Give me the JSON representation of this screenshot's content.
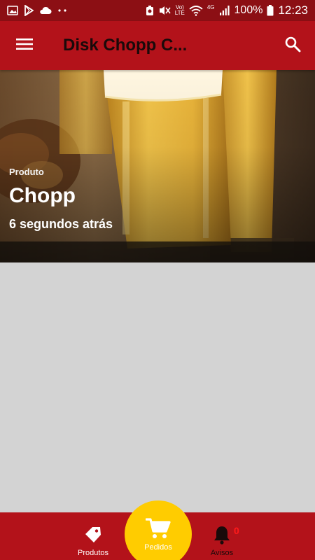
{
  "status_bar": {
    "battery_percent": "100%",
    "time": "12:23",
    "volte_label": "Vo)\nLTE",
    "network_label": "4G",
    "colors": {
      "background": "#8c0f14",
      "icons": "#ffffff"
    },
    "icons": [
      "gallery-icon",
      "play-store-icon",
      "cloud-icon",
      "dots-icon",
      "alarm-icon",
      "mute-icon",
      "volte-icon",
      "wifi-icon",
      "signal-icon",
      "battery-icon"
    ]
  },
  "app_bar": {
    "title": "Disk Chopp C...",
    "menu_icon": "hamburger-menu-icon",
    "search_icon": "search-icon",
    "background": "#b3121a"
  },
  "feed": {
    "items": [
      {
        "category": "Produto",
        "title": "Chopp",
        "time_ago": "6 segundos atrás"
      }
    ]
  },
  "bottom_nav": {
    "background": "#b3121a",
    "items": [
      {
        "label": "Produtos",
        "icon": "tag-icon"
      },
      {
        "label": "Pedidos",
        "icon": "cart-icon",
        "accent": "#ffcc00"
      },
      {
        "label": "Avisos",
        "icon": "bell-icon",
        "badge": "0"
      }
    ]
  }
}
